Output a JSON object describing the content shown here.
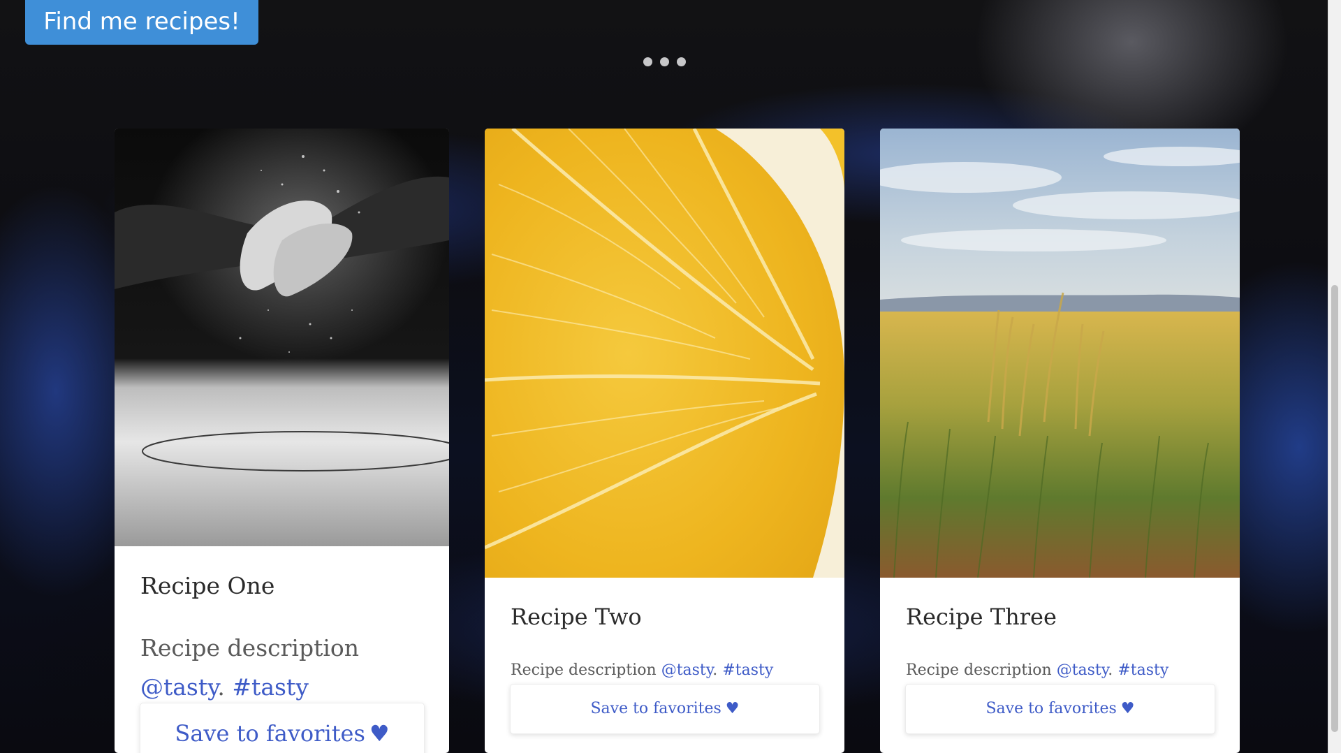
{
  "hero": {
    "cta_label": "Find me recipes!",
    "cta_color": "#3f8fd8"
  },
  "carousel": {
    "dots": [
      "slide-1",
      "slide-2",
      "slide-3"
    ]
  },
  "colors": {
    "link": "#3e5bc7",
    "title": "#2a2a2a",
    "text": "#5a5a5a"
  },
  "cards": [
    {
      "image": "flour-hands-photo",
      "title": "Recipe One",
      "description": "Recipe description",
      "mention": "@tasty",
      "separator": ".",
      "hashtag": "#tasty",
      "button_label": "Save to favorites",
      "button_icon": "♥"
    },
    {
      "image": "lemon-slice-photo",
      "title": "Recipe Two",
      "description": "Recipe description",
      "mention": "@tasty",
      "separator": ".",
      "hashtag": "#tasty",
      "button_label": "Save to favorites",
      "button_icon": "♥"
    },
    {
      "image": "wheat-field-photo",
      "title": "Recipe Three",
      "description": "Recipe description",
      "mention": "@tasty",
      "separator": ".",
      "hashtag": "#tasty",
      "button_label": "Save to favorites",
      "button_icon": "♥"
    }
  ]
}
